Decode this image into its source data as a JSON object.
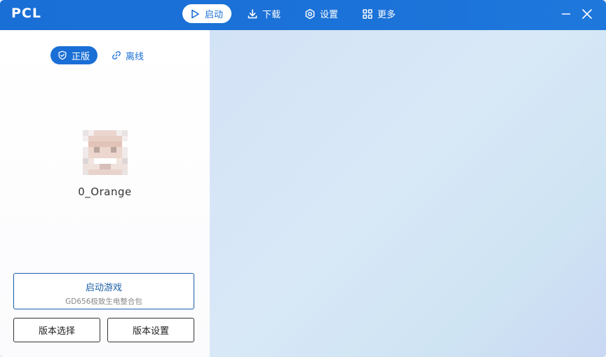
{
  "app": {
    "title": "PCL"
  },
  "nav": {
    "tabs": [
      {
        "label": "启动",
        "icon": "play-icon",
        "active": true
      },
      {
        "label": "下载",
        "icon": "download-icon",
        "active": false
      },
      {
        "label": "设置",
        "icon": "settings-icon",
        "active": false
      },
      {
        "label": "更多",
        "icon": "grid-icon",
        "active": false
      }
    ]
  },
  "window_controls": {
    "minimize": "minimize-icon",
    "close": "close-icon"
  },
  "account": {
    "mode_official": "正版",
    "mode_offline": "离线",
    "username": "0_Orange"
  },
  "launch": {
    "title": "启动游戏",
    "version": "GD656极致生电整合包"
  },
  "buttons": {
    "version_select": "版本选择",
    "version_settings": "版本设置"
  },
  "colors": {
    "accent": "#1a6fd6",
    "launch_border": "#1a5ea8"
  }
}
